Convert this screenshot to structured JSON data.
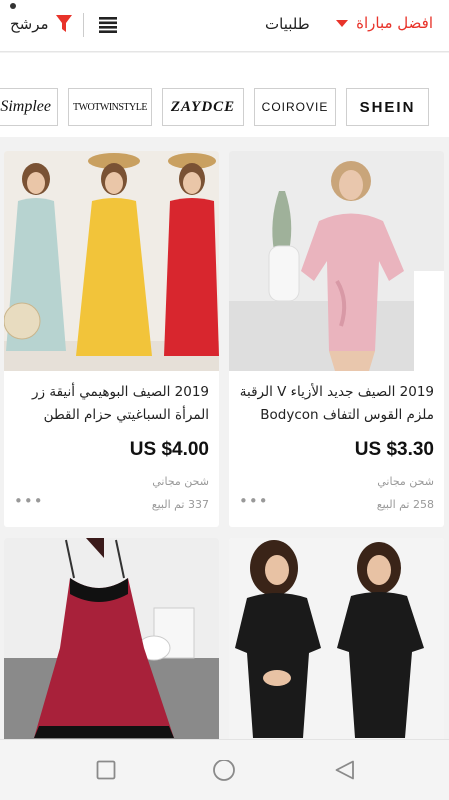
{
  "header": {
    "filter_label": "مرشح",
    "orders_label": "طلبيات",
    "sort_label": "افضل مباراة"
  },
  "brands": [
    "SHEIN",
    "COIROVIE",
    "ZAYDCE",
    "TWOTWINSTYLE",
    "Simplee"
  ],
  "products": [
    {
      "title": "2019 الصيف جديد الأزياء V الرقبة ملزم القوس التفاف Bodycon اللبا...",
      "price": "US $3.30",
      "shipping": "شحن مجاني",
      "sold": "258 تم البيع",
      "more": "•••"
    },
    {
      "title": "2019 الصيف البوهيمي أنيقة زر المرأة السباغيتي حزام القطن ميدي...",
      "price": "US $4.00",
      "shipping": "شحن مجاني",
      "sold": "337 تم البيع",
      "more": "•••"
    }
  ],
  "colors": {
    "accent": "#e8332a",
    "dress_pink": "#eab4be",
    "dress_blue": "#b7d3d0",
    "dress_yellow": "#f2c43a",
    "dress_red": "#d8262e",
    "dress_burgundy": "#a8213a",
    "dress_black": "#1a1a1a"
  },
  "icons": {
    "filter": "funnel-icon",
    "list": "list-view-icon",
    "sort": "caret-down-icon",
    "nav_recent": "square-icon",
    "nav_home": "circle-icon",
    "nav_back": "triangle-back-icon"
  }
}
